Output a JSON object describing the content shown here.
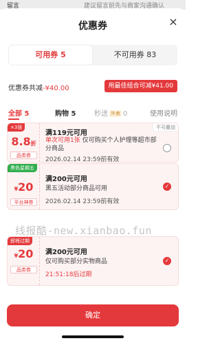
{
  "background": {
    "left_text": "留言",
    "right_text": "建议留言前先与商家沟通确认"
  },
  "sheet": {
    "title": "优惠券",
    "close_icon": "close-icon"
  },
  "tabs": {
    "available": "可用券 5",
    "unavailable": "不可用券 83"
  },
  "summary": {
    "label": "优惠券共减",
    "amount": "-¥40.00",
    "best_button": "用最佳组合可减¥41.00"
  },
  "filters": {
    "all": "全部 5",
    "shopping": "购物 5",
    "flash": "秒送",
    "flash_badge": "外卖",
    "flash_count": "0",
    "help": "使用说明"
  },
  "coupons": [
    {
      "tag": "×3张",
      "value": "8.8",
      "value_unit": "折",
      "category": "品类券",
      "title": "满119元可用",
      "desc_red": "单次可用1张",
      "desc": "仅可购买个人护理等超市部分商品",
      "date": "2026.02.14 23:59前有效",
      "stack_badge": "不可叠加",
      "selected": false
    },
    {
      "tag": "黑色星期五",
      "value_prefix": "¥",
      "value": "20",
      "category": "平台神券",
      "title": "满200元可用",
      "desc": "黑五活动部分商品可用",
      "date": "2026.02.14 23:59前有效",
      "selected": true
    },
    {
      "tag": "即将过期",
      "value_prefix": "¥",
      "value": "20",
      "category": "品类券",
      "title": "满200元可用",
      "desc": "仅可购买部分实物商品",
      "date": "21:51:18后过期",
      "selected": true
    }
  ],
  "watermark": "线报酷-new.xianbao.fun",
  "confirm_button": "确定",
  "colors": {
    "accent": "#e4393c",
    "green_tag": "#2fae4d"
  }
}
